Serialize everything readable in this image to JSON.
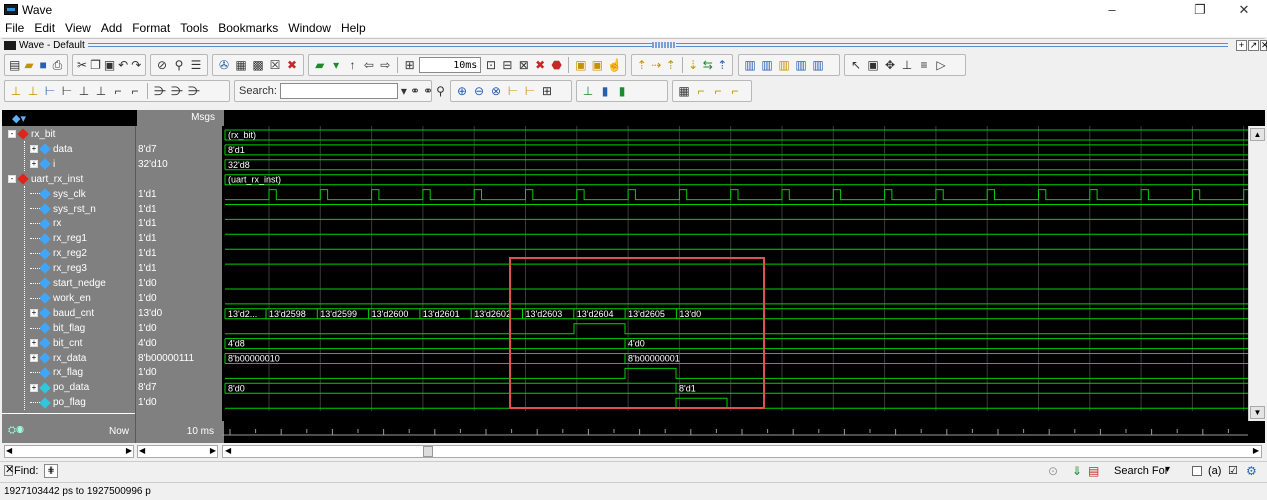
{
  "window": {
    "title": "Wave",
    "minimize_glyph": "–",
    "maximize_glyph": "❐",
    "close_glyph": "✕"
  },
  "menu": [
    "File",
    "Edit",
    "View",
    "Add",
    "Format",
    "Tools",
    "Bookmarks",
    "Window",
    "Help"
  ],
  "subwindow": {
    "title": "Wave - Default"
  },
  "toolbar": {
    "run_length": "10ms",
    "search_label": "Search:",
    "search_placeholder": ""
  },
  "wave_header": {
    "msgs_label": "Msgs"
  },
  "signals": [
    {
      "name": "rx_bit",
      "value": "",
      "level": 0,
      "kind": "group",
      "expand": "-"
    },
    {
      "name": "data",
      "value": "8'd7",
      "level": 1,
      "kind": "bus",
      "expand": "+"
    },
    {
      "name": "i",
      "value": "32'd10",
      "level": 1,
      "kind": "bus",
      "expand": "+"
    },
    {
      "name": "uart_rx_inst",
      "value": "",
      "level": 0,
      "kind": "group",
      "expand": "-"
    },
    {
      "name": "sys_clk",
      "value": "1'd1",
      "level": 1,
      "kind": "bit"
    },
    {
      "name": "sys_rst_n",
      "value": "1'd1",
      "level": 1,
      "kind": "bit"
    },
    {
      "name": "rx",
      "value": "1'd1",
      "level": 1,
      "kind": "bit"
    },
    {
      "name": "rx_reg1",
      "value": "1'd1",
      "level": 1,
      "kind": "bit"
    },
    {
      "name": "rx_reg2",
      "value": "1'd1",
      "level": 1,
      "kind": "bit"
    },
    {
      "name": "rx_reg3",
      "value": "1'd1",
      "level": 1,
      "kind": "bit"
    },
    {
      "name": "start_nedge",
      "value": "1'd0",
      "level": 1,
      "kind": "bit"
    },
    {
      "name": "work_en",
      "value": "1'd0",
      "level": 1,
      "kind": "bit"
    },
    {
      "name": "baud_cnt",
      "value": "13'd0",
      "level": 1,
      "kind": "bus",
      "expand": "+"
    },
    {
      "name": "bit_flag",
      "value": "1'd0",
      "level": 1,
      "kind": "bit"
    },
    {
      "name": "bit_cnt",
      "value": "4'd0",
      "level": 1,
      "kind": "bus",
      "expand": "+"
    },
    {
      "name": "rx_data",
      "value": "8'b00000111",
      "level": 1,
      "kind": "bus",
      "expand": "+"
    },
    {
      "name": "rx_flag",
      "value": "1'd0",
      "level": 1,
      "kind": "bit"
    },
    {
      "name": "po_data",
      "value": "8'd7",
      "level": 1,
      "kind": "bus",
      "expand": "+",
      "out": true
    },
    {
      "name": "po_flag",
      "value": "1'd0",
      "level": 1,
      "kind": "bit",
      "out": true
    }
  ],
  "wave_labels": {
    "rx_bit": "(rx_bit)",
    "data": "8'd1",
    "i": "32'd8",
    "uart_rx_inst": "(uart_rx_inst)",
    "baud_cnt": [
      "13'd2...",
      "13'd2598",
      "13'd2599",
      "13'd2600",
      "13'd2601",
      "13'd2602",
      "13'd2603",
      "13'd2604",
      "13'd2605",
      "13'd0"
    ],
    "bit_cnt": [
      "4'd8",
      "4'd0"
    ],
    "rx_data": [
      "8'b00000010",
      "8'b00000001"
    ],
    "po_data": [
      "8'd0",
      "8'd1"
    ]
  },
  "cursor": {
    "label": "Now",
    "value": "10 ms"
  },
  "findbar": {
    "label": "Find:",
    "search_for": "Search For",
    "option_label": "(a)"
  },
  "status": {
    "text": "1927103442 ps to 1927500996 p"
  },
  "colors": {
    "wave": "#00d000",
    "highlight": "#e05050",
    "background": "#000000"
  }
}
